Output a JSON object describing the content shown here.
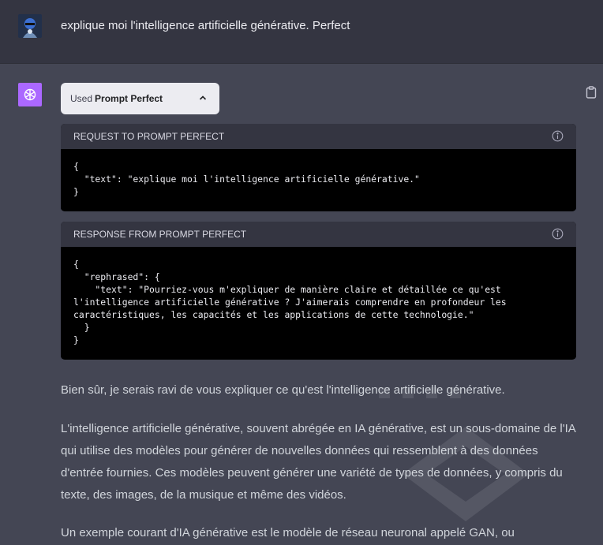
{
  "user": {
    "message": "explique moi l'intelligence artificielle générative. Perfect"
  },
  "plugin": {
    "used_label": "Used",
    "name": "Prompt Perfect"
  },
  "request": {
    "header": "REQUEST TO PROMPT PERFECT",
    "body": "{\n  \"text\": \"explique moi l'intelligence artificielle générative.\"\n}"
  },
  "response": {
    "header": "RESPONSE FROM PROMPT PERFECT",
    "body": "{\n  \"rephrased\": {\n    \"text\": \"Pourriez-vous m'expliquer de manière claire et détaillée ce qu'est\nl'intelligence artificielle générative ? J'aimerais comprendre en profondeur les\ncaractéristiques, les capacités et les applications de cette technologie.\"\n  }\n}"
  },
  "answer": {
    "p1": "Bien sûr, je serais ravi de vous expliquer ce qu'est l'intelligence artificielle générative.",
    "p2": "L'intelligence artificielle générative, souvent abrégée en IA générative, est un sous-domaine de l'IA qui utilise des modèles pour générer de nouvelles données qui ressemblent à des données d'entrée fournies. Ces modèles peuvent générer une variété de types de données, y compris du texte, des images, de la musique et même des vidéos.",
    "p3": "Un exemple courant d'IA générative est le modèle de réseau neuronal appelé GAN, ou"
  },
  "icons": {
    "user_avatar": "user-avatar",
    "assistant_avatar": "openai-logo-icon",
    "copy": "clipboard-icon",
    "collapse": "chevron-up-icon",
    "info": "info-icon"
  }
}
